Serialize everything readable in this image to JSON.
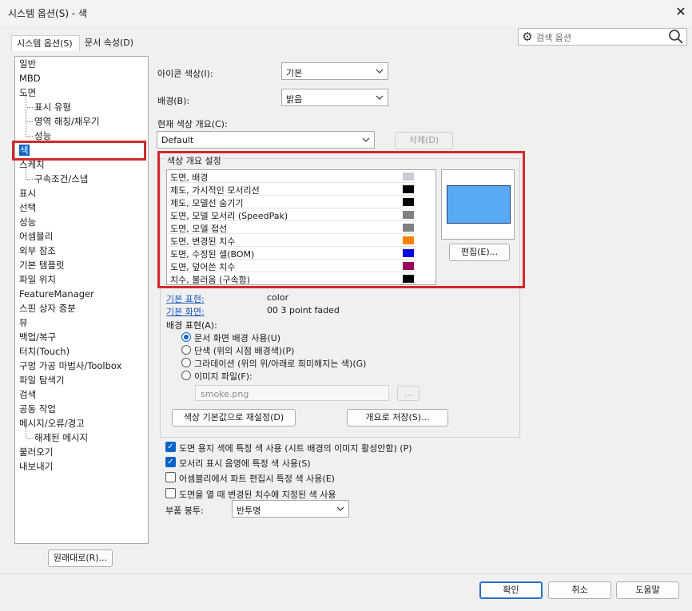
{
  "window": {
    "title": "시스템 옵션(S) - 색",
    "close_glyph": "✕"
  },
  "tabs": [
    {
      "label": "시스템 옵션(S)"
    },
    {
      "label": "문서 속성(D)"
    }
  ],
  "search": {
    "placeholder": "검색 옵션"
  },
  "tree": {
    "items": [
      {
        "label": "일반"
      },
      {
        "label": "MBD"
      },
      {
        "label": "도면"
      },
      {
        "label": "표시 유형"
      },
      {
        "label": "영역 해칭/채우기"
      },
      {
        "label": "성능"
      },
      {
        "label": "색"
      },
      {
        "label": "스케치"
      },
      {
        "label": "구속조건/스냅"
      },
      {
        "label": "표시"
      },
      {
        "label": "선택"
      },
      {
        "label": "성능"
      },
      {
        "label": "어셈블리"
      },
      {
        "label": "외부 참조"
      },
      {
        "label": "기본 템플릿"
      },
      {
        "label": "파일 위치"
      },
      {
        "label": "FeatureManager"
      },
      {
        "label": "스핀 상자 증분"
      },
      {
        "label": "뷰"
      },
      {
        "label": "백업/복구"
      },
      {
        "label": "터치(Touch)"
      },
      {
        "label": "구멍 가공 마법사/Toolbox"
      },
      {
        "label": "파일 탐색기"
      },
      {
        "label": "검색"
      },
      {
        "label": "공동 작업"
      },
      {
        "label": "메시지/오류/경고"
      },
      {
        "label": "해제된 메시지"
      },
      {
        "label": "불러오기"
      },
      {
        "label": "내보내기"
      }
    ],
    "reset_button": "원래대로(R)..."
  },
  "colors": {
    "icon_color_label": "아이콘 색상(I):",
    "icon_color_value": "기본",
    "background_label": "배경(B):",
    "background_value": "밝음",
    "scheme_label": "현재 색상 개요(C):",
    "scheme_value": "Default",
    "delete_button": "삭제(D)",
    "scheme_group_title": "색상 개요 설정",
    "scheme_items": [
      {
        "label": "도면, 배경",
        "color": "#c9ccd3"
      },
      {
        "label": "제도, 가시적인 모서리선",
        "color": "#000000"
      },
      {
        "label": "제도, 모델선 숨기기",
        "color": "#000000"
      },
      {
        "label": "도면, 모델 모서리 (SpeedPak)",
        "color": "#808080"
      },
      {
        "label": "도면, 모델 접선",
        "color": "#808080"
      },
      {
        "label": "도면, 변경된 치수",
        "color": "#ff8000"
      },
      {
        "label": "도면, 수정된 셀(BOM)",
        "color": "#0000e6"
      },
      {
        "label": "도면, 덮어쓴 치수",
        "color": "#99005a"
      },
      {
        "label": "치수, 불러옴 (구속함)",
        "color": "#000000"
      }
    ],
    "preview_color": "#5aa9f5",
    "edit_button": "편집(E)...",
    "default_appearance_label": "기본 표현:",
    "default_appearance_value": "color",
    "default_scene_label": "기본 화면:",
    "default_scene_value": "00 3 point faded",
    "bg_appearance_label": "배경 표현(A):",
    "bg_options": [
      {
        "label": "문서 화면 배경 사용(U)",
        "selected": true
      },
      {
        "label": "단색 (위의 시점 배경색)(P)",
        "selected": false
      },
      {
        "label": "그라데이션 (위의 위/아래로 희미해지는 색)(G)",
        "selected": false
      },
      {
        "label": "이미지 파일(F):",
        "selected": false
      }
    ],
    "image_file_value": "smoke.png",
    "browse_button": "...",
    "reset_colors_button": "색상 기본값으로 재설정(D)",
    "save_scheme_button": "개요로 저장(S)...",
    "checkboxes": [
      {
        "label": "도면 용지 색에 특정 색 사용 (시트 배경의 이미지 활성안함) (P)",
        "checked": true
      },
      {
        "label": "모서리 표시 음영에 특정 색 사용(S)",
        "checked": true
      },
      {
        "label": "어셈블리에서 파트 편집시 특정 색 사용(E)",
        "checked": false
      },
      {
        "label": "도면을 열 때 변경된 치수에 지정된 색 사용",
        "checked": false
      }
    ],
    "envelope_label": "부품 봉투:",
    "envelope_value": "반투명"
  },
  "footer": {
    "ok": "확인",
    "cancel": "취소",
    "help": "도움말"
  },
  "accent": "#d4282c"
}
